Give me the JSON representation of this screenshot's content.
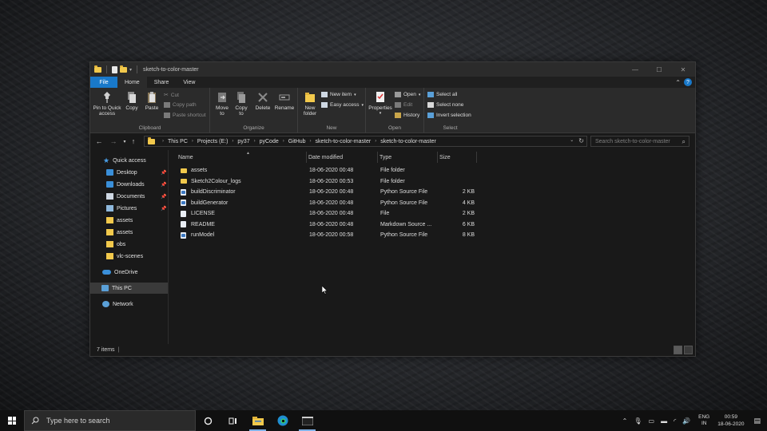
{
  "window": {
    "title": "sketch-to-color-master"
  },
  "ribbon": {
    "tabs": [
      "File",
      "Home",
      "Share",
      "View"
    ],
    "clipboard": {
      "label": "Clipboard",
      "pin": "Pin to Quick access",
      "copy": "Copy",
      "paste": "Paste",
      "cut": "Cut",
      "copy_path": "Copy path",
      "paste_shortcut": "Paste shortcut"
    },
    "organize": {
      "label": "Organize",
      "move_to": "Move to",
      "copy_to": "Copy to",
      "delete": "Delete",
      "rename": "Rename"
    },
    "new": {
      "label": "New",
      "new_folder": "New folder",
      "new_item": "New item",
      "easy_access": "Easy access"
    },
    "open": {
      "label": "Open",
      "properties": "Properties",
      "open": "Open",
      "edit": "Edit",
      "history": "History"
    },
    "select": {
      "label": "Select",
      "select_all": "Select all",
      "select_none": "Select none",
      "invert_selection": "Invert selection"
    }
  },
  "address": {
    "crumbs": [
      "This PC",
      "Projects (E:)",
      "py37",
      "pyCode",
      "GitHub",
      "sketch-to-color-master",
      "sketch-to-color-master"
    ],
    "search_placeholder": "Search sketch-to-color-master"
  },
  "sidebar": {
    "quick_access": "Quick access",
    "items": [
      "Desktop",
      "Downloads",
      "Documents",
      "Pictures",
      "assets",
      "assets",
      "obs",
      "vlc-scenes"
    ],
    "onedrive": "OneDrive",
    "this_pc": "This PC",
    "network": "Network"
  },
  "columns": [
    "Name",
    "Date modified",
    "Type",
    "Size"
  ],
  "files": [
    {
      "name": "assets",
      "date": "18-06-2020 00:48",
      "type": "File folder",
      "size": "",
      "kind": "folder"
    },
    {
      "name": "Sketch2Colour_logs",
      "date": "18-06-2020 00:53",
      "type": "File folder",
      "size": "",
      "kind": "folder"
    },
    {
      "name": "buildDiscriminator",
      "date": "18-06-2020 00:48",
      "type": "Python Source File",
      "size": "2 KB",
      "kind": "py"
    },
    {
      "name": "buildGenerator",
      "date": "18-06-2020 00:48",
      "type": "Python Source File",
      "size": "4 KB",
      "kind": "py"
    },
    {
      "name": "LICENSE",
      "date": "18-06-2020 00:48",
      "type": "File",
      "size": "2 KB",
      "kind": "doc"
    },
    {
      "name": "README",
      "date": "18-06-2020 00:48",
      "type": "Markdown Source ...",
      "size": "6 KB",
      "kind": "doc"
    },
    {
      "name": "runModel",
      "date": "18-06-2020 00:58",
      "type": "Python Source File",
      "size": "8 KB",
      "kind": "py"
    }
  ],
  "status": {
    "items": "7 items"
  },
  "taskbar": {
    "search_placeholder": "Type here to search",
    "lang_line1": "ENG",
    "lang_line2": "IN",
    "time": "00:59",
    "date": "18-06-2020"
  },
  "colors": {
    "accent": "#1979ca",
    "folder": "#f2c94c",
    "background": "#191919"
  }
}
